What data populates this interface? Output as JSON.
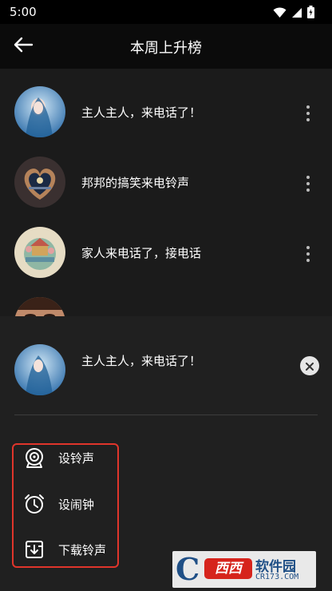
{
  "status_bar": {
    "time": "5:00",
    "icons": [
      "wifi-icon",
      "signal-icon",
      "battery-icon"
    ]
  },
  "app_bar": {
    "back_icon": "arrow-left-icon",
    "title": "本周上升榜"
  },
  "ringtone_list": [
    {
      "title": "主人主人，来电话了！"
    },
    {
      "title": "邦邦的搞笑来电铃声"
    },
    {
      "title": "家人来电话了，接电话"
    },
    {
      "title": ""
    }
  ],
  "bottom_sheet": {
    "selected_title": "主人主人，来电话了！",
    "close_icon": "close-icon",
    "actions": [
      {
        "label": "设铃声",
        "icon": "ringtone-icon"
      },
      {
        "label": "设闹钟",
        "icon": "alarm-clock-icon"
      },
      {
        "label": "下载铃声",
        "icon": "download-icon"
      }
    ]
  },
  "watermark": {
    "letter": "C",
    "badge": "西西",
    "text": "软件园",
    "domain": "CR173.COM"
  },
  "colors": {
    "highlight_border": "#e0352b",
    "sheet_background": "#202020",
    "list_background": "#1b1b1b"
  }
}
